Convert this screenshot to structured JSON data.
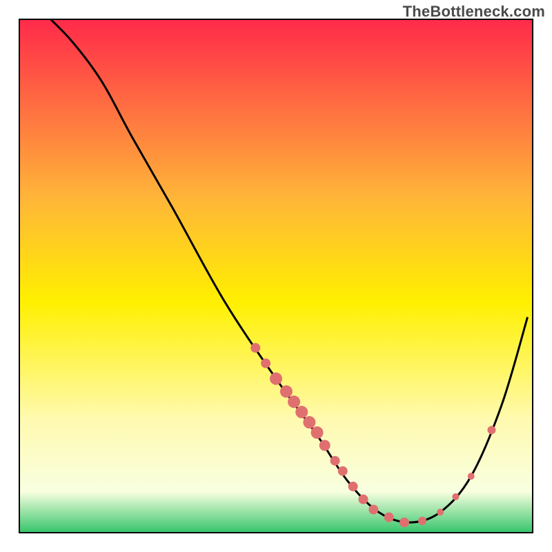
{
  "watermark": "TheBottleneck.com",
  "colors": {
    "gradient_top": "#ff2a4a",
    "gradient_upper_mid": "#ffb638",
    "gradient_mid": "#fff000",
    "gradient_lower_mid": "#fffab0",
    "gradient_lower": "#f8ffe0",
    "gradient_bottom": "#35c56a",
    "curve": "#000000",
    "dot": "#e07070",
    "frame": "#000000"
  },
  "chart_data": {
    "type": "line",
    "title": "",
    "xlabel": "",
    "ylabel": "",
    "xlim": [
      0,
      100
    ],
    "ylim": [
      0,
      100
    ],
    "curve": [
      {
        "x": 4,
        "y": 102
      },
      {
        "x": 10,
        "y": 96
      },
      {
        "x": 16,
        "y": 88
      },
      {
        "x": 22,
        "y": 77
      },
      {
        "x": 30,
        "y": 63
      },
      {
        "x": 40,
        "y": 45
      },
      {
        "x": 50,
        "y": 30
      },
      {
        "x": 58,
        "y": 19
      },
      {
        "x": 64,
        "y": 10
      },
      {
        "x": 70,
        "y": 4
      },
      {
        "x": 76,
        "y": 2
      },
      {
        "x": 82,
        "y": 4
      },
      {
        "x": 88,
        "y": 11
      },
      {
        "x": 94,
        "y": 25
      },
      {
        "x": 99,
        "y": 42
      }
    ],
    "dots": [
      {
        "x": 46,
        "y": 36,
        "r": 7
      },
      {
        "x": 48,
        "y": 33,
        "r": 7
      },
      {
        "x": 50,
        "y": 30,
        "r": 9
      },
      {
        "x": 52,
        "y": 27.5,
        "r": 9
      },
      {
        "x": 53.5,
        "y": 25.5,
        "r": 9
      },
      {
        "x": 55,
        "y": 23.5,
        "r": 9
      },
      {
        "x": 56.5,
        "y": 21.5,
        "r": 9
      },
      {
        "x": 58,
        "y": 19.5,
        "r": 9
      },
      {
        "x": 59.5,
        "y": 17,
        "r": 8
      },
      {
        "x": 61.5,
        "y": 14,
        "r": 7
      },
      {
        "x": 63,
        "y": 12,
        "r": 7
      },
      {
        "x": 65,
        "y": 9,
        "r": 7
      },
      {
        "x": 67,
        "y": 6.5,
        "r": 7
      },
      {
        "x": 69,
        "y": 4.5,
        "r": 7
      },
      {
        "x": 72,
        "y": 3,
        "r": 7
      },
      {
        "x": 75,
        "y": 2,
        "r": 7
      },
      {
        "x": 78.5,
        "y": 2.3,
        "r": 6
      },
      {
        "x": 82,
        "y": 4,
        "r": 5
      },
      {
        "x": 85,
        "y": 7,
        "r": 5
      },
      {
        "x": 88,
        "y": 11,
        "r": 5
      },
      {
        "x": 92,
        "y": 20,
        "r": 6
      }
    ]
  }
}
